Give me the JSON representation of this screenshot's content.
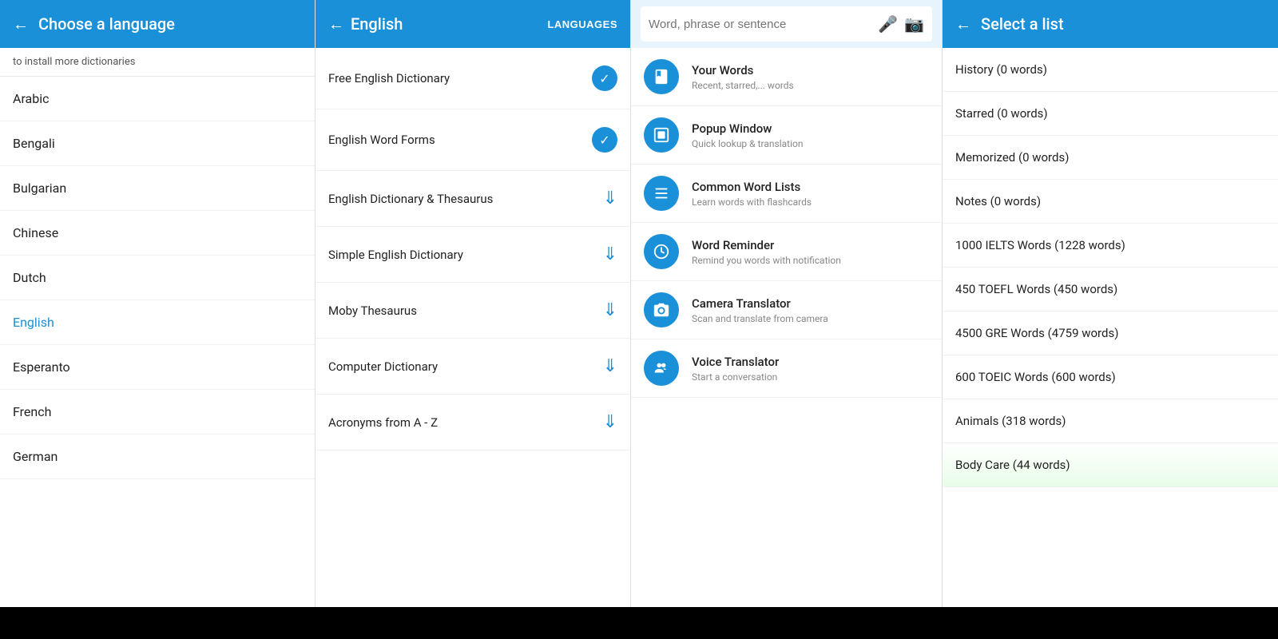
{
  "panel1": {
    "header": {
      "back_label": "←",
      "title": "Choose a language"
    },
    "subtext": "to install more dictionaries",
    "languages": [
      {
        "name": "Arabic",
        "active": false
      },
      {
        "name": "Bengali",
        "active": false
      },
      {
        "name": "Bulgarian",
        "active": false
      },
      {
        "name": "Chinese",
        "active": false
      },
      {
        "name": "Dutch",
        "active": false
      },
      {
        "name": "English",
        "active": true
      },
      {
        "name": "Esperanto",
        "active": false
      },
      {
        "name": "French",
        "active": false
      },
      {
        "name": "German",
        "active": false
      }
    ]
  },
  "panel2": {
    "header": {
      "back_label": "←",
      "title": "English",
      "lang_btn": "LANGUAGES"
    },
    "dictionaries": [
      {
        "name": "Free English Dictionary",
        "status": "check"
      },
      {
        "name": "English Word Forms",
        "status": "check"
      },
      {
        "name": "English Dictionary & Thesaurus",
        "status": "download"
      },
      {
        "name": "Simple English Dictionary",
        "status": "download"
      },
      {
        "name": "Moby Thesaurus",
        "status": "download"
      },
      {
        "name": "Computer Dictionary",
        "status": "download"
      },
      {
        "name": "Acronyms from A - Z",
        "status": "download"
      }
    ]
  },
  "panel3": {
    "search": {
      "placeholder": "Word, phrase or sentence"
    },
    "features": [
      {
        "icon": "book",
        "title": "Your Words",
        "subtitle": "Recent, starred,... words"
      },
      {
        "icon": "popup",
        "title": "Popup Window",
        "subtitle": "Quick lookup & translation"
      },
      {
        "icon": "list",
        "title": "Common Word Lists",
        "subtitle": "Learn words with flashcards"
      },
      {
        "icon": "clock",
        "title": "Word Reminder",
        "subtitle": "Remind you words with notification"
      },
      {
        "icon": "camera",
        "title": "Camera Translator",
        "subtitle": "Scan and translate from camera"
      },
      {
        "icon": "voice",
        "title": "Voice Translator",
        "subtitle": "Start a conversation"
      }
    ]
  },
  "panel4": {
    "header": {
      "back_label": "←",
      "title": "Select a list"
    },
    "lists": [
      {
        "name": "History (0 words)"
      },
      {
        "name": "Starred (0 words)"
      },
      {
        "name": "Memorized (0 words)"
      },
      {
        "name": "Notes (0 words)"
      },
      {
        "name": "1000 IELTS Words (1228 words)"
      },
      {
        "name": "450 TOEFL Words (450 words)"
      },
      {
        "name": "4500 GRE Words (4759 words)"
      },
      {
        "name": "600 TOEIC Words (600 words)"
      },
      {
        "name": "Animals (318 words)"
      },
      {
        "name": "Body Care (44 words)"
      }
    ]
  },
  "colors": {
    "blue": "#1a90d9",
    "light_blue_bg": "#e8f4fd"
  }
}
